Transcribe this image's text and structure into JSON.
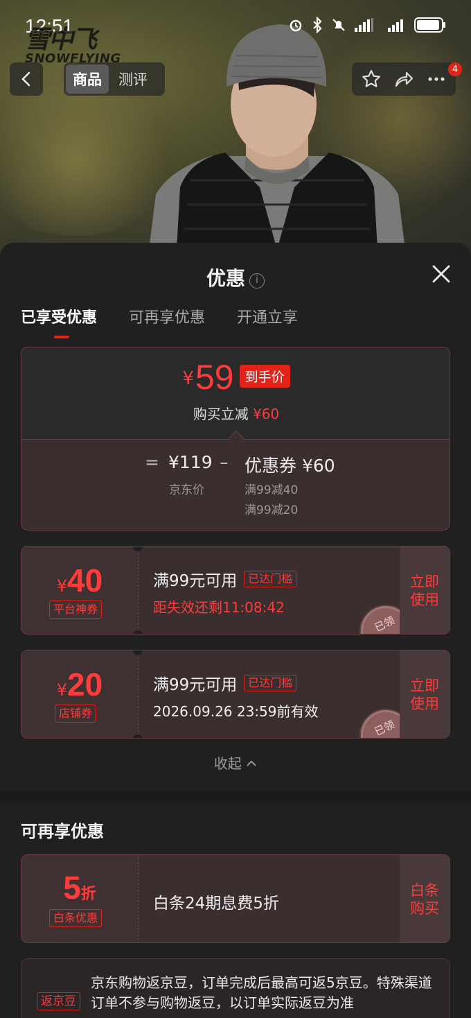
{
  "status_bar": {
    "time": "12:51"
  },
  "brand": {
    "logo_cn": "雪中飞",
    "logo_en": "SNOWFLYING"
  },
  "nav": {
    "tabs": [
      {
        "label": "商品"
      },
      {
        "label": "测评"
      }
    ],
    "cart_badge": "4"
  },
  "sheet": {
    "title": "优惠",
    "tabs": [
      {
        "label": "已享受优惠"
      },
      {
        "label": "可再享优惠"
      },
      {
        "label": "开通立享"
      }
    ],
    "price_card": {
      "currency": "¥",
      "final_price": "59",
      "final_label": "到手价",
      "discount_text": "购买立减",
      "discount_amount": "¥60",
      "equals": "=",
      "base_price": "¥119",
      "base_label": "京东价",
      "minus": "–",
      "coupon_label": "优惠券 ¥60",
      "coupon_details": [
        "满99减40",
        "满99减20"
      ]
    },
    "coupons": [
      {
        "currency": "¥",
        "amount": "40",
        "type": "平台神券",
        "condition": "满99元可用",
        "reach": "已达门槛",
        "meta": "距失效还剩11:08:42",
        "meta_color": "#ff3b3b",
        "action": "立即使用",
        "stamp": "已领"
      },
      {
        "currency": "¥",
        "amount": "20",
        "type": "店铺券",
        "condition": "满99元可用",
        "reach": "已达门槛",
        "meta": "2026.09.26 23:59前有效",
        "meta_color": "#f0f0f0",
        "action": "立即使用",
        "stamp": "已领"
      }
    ],
    "collapse_label": "收起"
  },
  "more_offers": {
    "title": "可再享优惠",
    "baitiao": {
      "amount": "5",
      "unit": "折",
      "type": "白条优惠",
      "desc": "白条24期息费5折",
      "action": "白条购买"
    },
    "bean": {
      "tag": "返京豆",
      "text": "京东购物返京豆，订单完成后最高可返5京豆。特殊渠道订单不参与购物返豆，以订单实际返豆为准"
    }
  },
  "colors": {
    "accent": "#e2231a",
    "price_red": "#ff3b3b",
    "sheet_bg": "#202020"
  }
}
